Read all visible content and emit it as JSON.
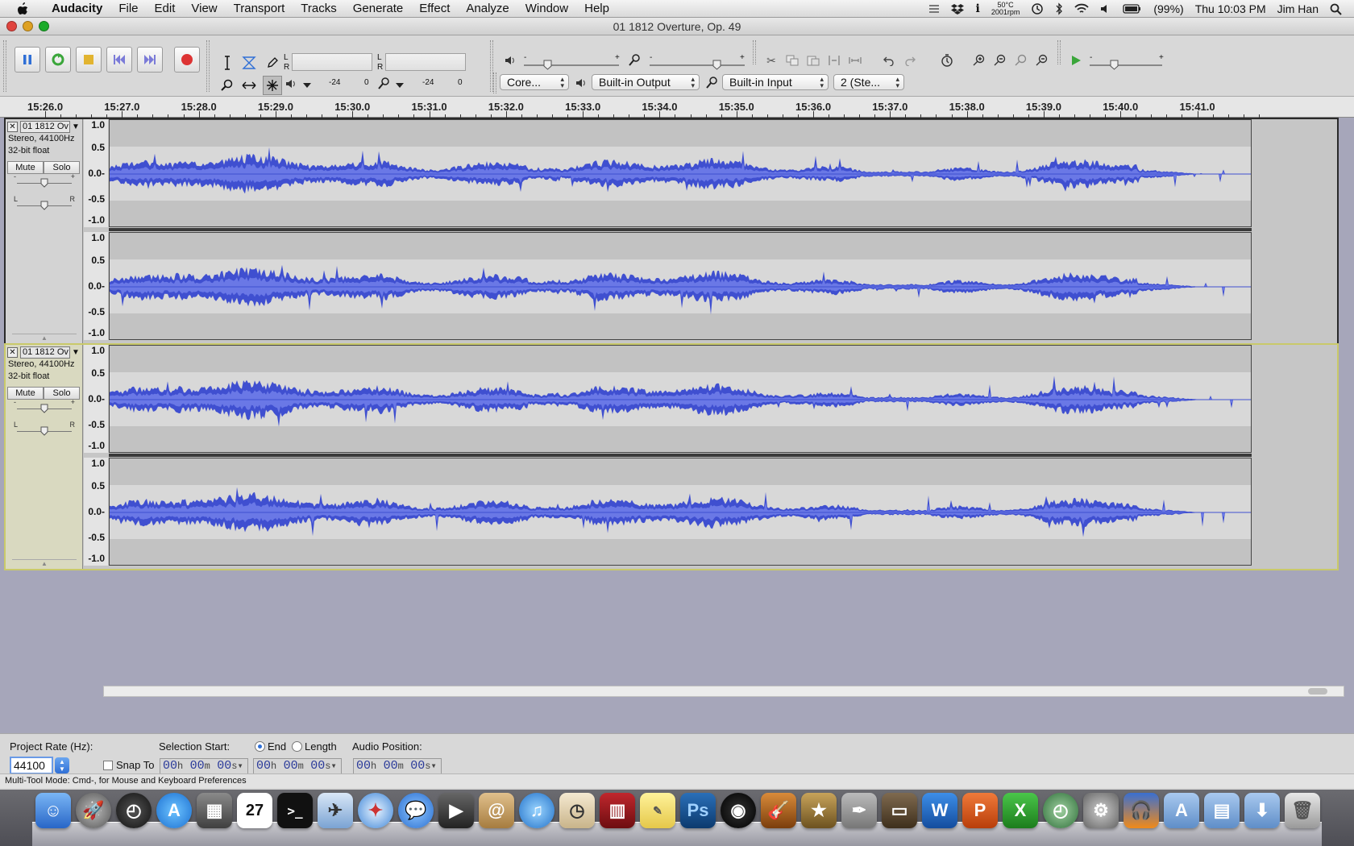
{
  "menubar": {
    "app": "Audacity",
    "items": [
      "File",
      "Edit",
      "View",
      "Transport",
      "Tracks",
      "Generate",
      "Effect",
      "Analyze",
      "Window",
      "Help"
    ],
    "status": {
      "temp": "50°C",
      "rpm": "2001rpm",
      "battery": "(99%)",
      "clock": "Thu 10:03 PM",
      "user": "Jim Han"
    }
  },
  "window": {
    "title": "01 1812 Overture, Op. 49"
  },
  "meters": {
    "play_label_l": "L",
    "play_label_r": "R",
    "rec_label_l": "L",
    "rec_label_r": "R",
    "play_db": "-24",
    "play_zero": "0",
    "rec_db": "-24",
    "rec_zero": "0"
  },
  "device": {
    "host": "Core...",
    "output": "Built-in Output",
    "input": "Built-in Input",
    "channels": "2 (Ste..."
  },
  "slider_marks": {
    "minus": "-",
    "plus": "+"
  },
  "ruler": {
    "labels": [
      "15:26.0",
      "15:27.0",
      "15:28.0",
      "15:29.0",
      "15:30.0",
      "15:31.0",
      "15:32.0",
      "15:33.0",
      "15:34.0",
      "15:35.0",
      "15:36.0",
      "15:37.0",
      "15:38.0",
      "15:39.0",
      "15:40.0",
      "15:41.0"
    ]
  },
  "tracks": [
    {
      "name": "01 1812 Ov",
      "format": "Stereo, 44100Hz",
      "depth": "32-bit float",
      "mute": "Mute",
      "solo": "Solo",
      "gain_minus": "-",
      "gain_plus": "+",
      "pan_l": "L",
      "pan_r": "R",
      "scale": [
        "1.0",
        "0.5",
        "0.0-",
        "-0.5",
        "-1.0"
      ]
    },
    {
      "name": "01 1812 Ov",
      "format": "Stereo, 44100Hz",
      "depth": "32-bit float",
      "mute": "Mute",
      "solo": "Solo",
      "gain_minus": "-",
      "gain_plus": "+",
      "pan_l": "L",
      "pan_r": "R",
      "scale": [
        "1.0",
        "0.5",
        "0.0-",
        "-0.5",
        "-1.0"
      ]
    }
  ],
  "selection": {
    "project_rate_label": "Project Rate (Hz):",
    "project_rate_value": "44100",
    "snap_to": "Snap To",
    "selection_start_label": "Selection Start:",
    "end_label": "End",
    "length_label": "Length",
    "audio_position_label": "Audio Position:",
    "time_hh": "00",
    "time_mm": "00",
    "time_ss": "00",
    "unit_h": "h",
    "unit_m": "m",
    "unit_s": "s"
  },
  "status": {
    "text": "Multi-Tool Mode: Cmd-, for Mouse and Keyboard Preferences"
  },
  "dock": {
    "calendar_day": "27",
    "icons": [
      "Finder",
      "Launchpad",
      "Dashboard",
      "App Store",
      "Photo Browser",
      "Calendar",
      "Terminal",
      "Preview",
      "Safari",
      "iChat",
      "FaceTime",
      "Address Book",
      "iTunes",
      "Time",
      "Photo Booth",
      "Stickies",
      "Photoshop",
      "Aperture",
      "GarageBand",
      "iMovie",
      "Script Editor",
      "Keynote",
      "Word",
      "PowerPoint",
      "Excel",
      "Time Machine",
      "System Preferences",
      "Audacity",
      "Applications",
      "Documents",
      "Downloads",
      "Trash"
    ]
  }
}
